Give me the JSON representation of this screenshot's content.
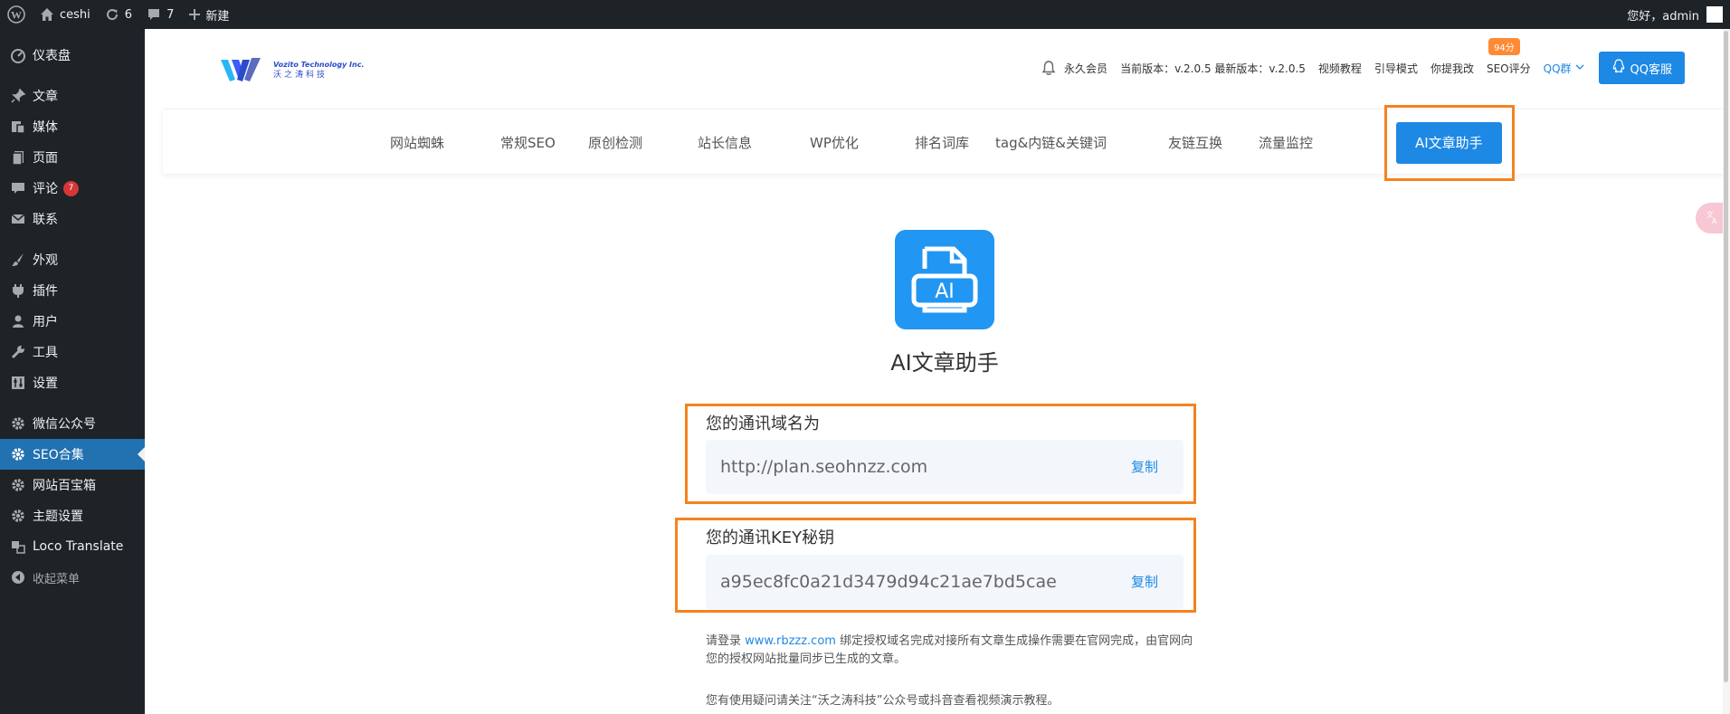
{
  "adminbar": {
    "site_name": "ceshi",
    "updates_count": "6",
    "comments_count": "7",
    "new_label": "新建",
    "greeting": "您好，admin"
  },
  "sidebar": {
    "items": [
      {
        "label": "仪表盘",
        "icon": "dashboard-icon"
      },
      {
        "label": "文章",
        "icon": "pin-icon"
      },
      {
        "label": "媒体",
        "icon": "media-icon"
      },
      {
        "label": "页面",
        "icon": "page-icon"
      },
      {
        "label": "评论",
        "icon": "comment-icon",
        "badge": "7"
      },
      {
        "label": "联系",
        "icon": "mail-icon"
      },
      {
        "label": "外观",
        "icon": "brush-icon"
      },
      {
        "label": "插件",
        "icon": "plugin-icon"
      },
      {
        "label": "用户",
        "icon": "user-icon"
      },
      {
        "label": "工具",
        "icon": "wrench-icon"
      },
      {
        "label": "设置",
        "icon": "settings-icon"
      },
      {
        "label": "微信公众号",
        "icon": "gear-icon"
      },
      {
        "label": "SEO合集",
        "icon": "gear-icon",
        "active": true
      },
      {
        "label": "网站百宝箱",
        "icon": "gear-icon"
      },
      {
        "label": "主题设置",
        "icon": "gear-icon"
      },
      {
        "label": "Loco Translate",
        "icon": "translate-icon"
      },
      {
        "label": "收起菜单",
        "icon": "collapse-icon"
      }
    ]
  },
  "header": {
    "logo_en": "Vozito Technology Inc.",
    "logo_cn": "沃之涛科技",
    "member": "永久会员",
    "version": "当前版本：v.2.0.5 最新版本：v.2.0.5",
    "video_tutorial": "视频教程",
    "guide_mode": "引导模式",
    "feedback": "你提我改",
    "seo_score": "SEO评分",
    "score_badge": "94分",
    "qq_group": "QQ群",
    "qq_service": "QQ客服"
  },
  "tabs": [
    "网站蜘蛛",
    "常规SEO",
    "原创检测",
    "站长信息",
    "WP优化",
    "排名词库",
    "tag&内链&关键词",
    "友链互换",
    "流量监控",
    "AI文章助手"
  ],
  "main": {
    "icon_text": "AI",
    "title": "AI文章助手",
    "domain_label": "您的通讯域名为",
    "domain_value": "http://plan.seohnzz.com",
    "key_label": "您的通讯KEY秘钥",
    "key_value": "a95ec8fc0a21d3479d94c21ae7bd5cae",
    "copy_label": "复制",
    "note1_prefix": "请登录 ",
    "note1_link": "www.rbzzz.com",
    "note1_suffix": " 绑定授权域名完成对接所有文章生成操作需要在官网完成，由官网向您的授权网站批量同步已生成的文章。",
    "note2": "您有使用疑问请关注“沃之涛科技”公众号或抖音查看视频演示教程。"
  },
  "colors": {
    "accent": "#1e88e5",
    "highlight": "#f58220",
    "admin_dark": "#1d2327",
    "active_menu": "#2271b1"
  }
}
